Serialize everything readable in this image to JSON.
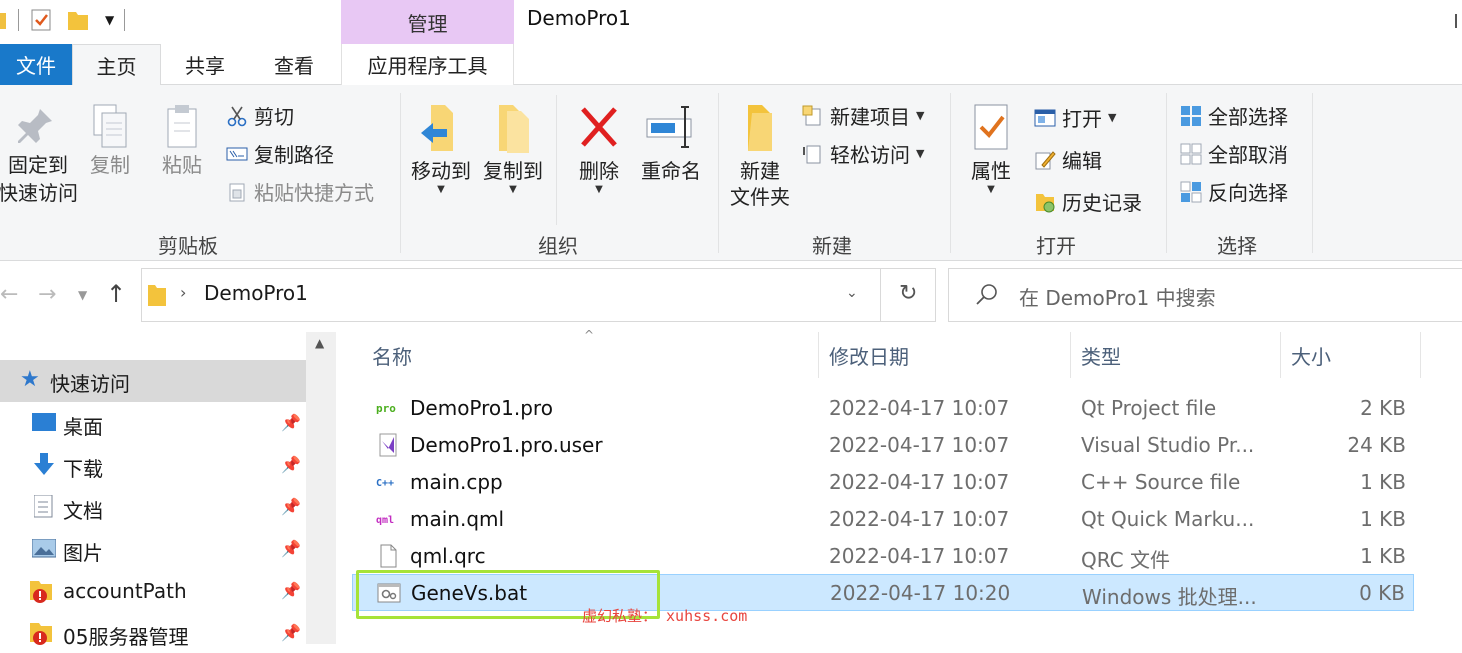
{
  "window": {
    "title": "DemoPro1",
    "context_tab_header": "管理"
  },
  "tabs": {
    "file": "文件",
    "home": "主页",
    "share": "共享",
    "view": "查看",
    "app_tools": "应用程序工具"
  },
  "ribbon": {
    "clipboard": {
      "label": "剪贴板",
      "pin_quick_line1": "固定到",
      "pin_quick_line2": "快速访问",
      "copy": "复制",
      "paste": "粘贴",
      "cut": "剪切",
      "copy_path": "复制路径",
      "paste_shortcut": "粘贴快捷方式"
    },
    "organize": {
      "label": "组织",
      "move_to": "移动到",
      "copy_to": "复制到",
      "delete": "删除",
      "rename": "重命名"
    },
    "new": {
      "label": "新建",
      "new_folder_line1": "新建",
      "new_folder_line2": "文件夹",
      "new_item": "新建项目",
      "easy_access": "轻松访问"
    },
    "open": {
      "label": "打开",
      "properties": "属性",
      "open": "打开",
      "edit": "编辑",
      "history": "历史记录"
    },
    "select": {
      "label": "选择",
      "select_all": "全部选择",
      "select_none": "全部取消",
      "invert": "反向选择"
    }
  },
  "address": {
    "path": "DemoPro1",
    "search_placeholder": "在 DemoPro1 中搜索"
  },
  "nav": {
    "quick_access": "快速访问",
    "items": [
      {
        "label": "桌面",
        "icon": "desktop-icon"
      },
      {
        "label": "下载",
        "icon": "download-icon"
      },
      {
        "label": "文档",
        "icon": "document-icon"
      },
      {
        "label": "图片",
        "icon": "picture-icon"
      },
      {
        "label": "accountPath",
        "icon": "folder-icon"
      },
      {
        "label": "05服务器管理",
        "icon": "folder-icon"
      }
    ]
  },
  "columns": {
    "name": "名称",
    "modified": "修改日期",
    "type": "类型",
    "size": "大小"
  },
  "files": [
    {
      "name": "DemoPro1.pro",
      "modified": "2022-04-17 10:07",
      "type": "Qt Project file",
      "size": "2 KB",
      "icon": "pro-file-icon"
    },
    {
      "name": "DemoPro1.pro.user",
      "modified": "2022-04-17 10:07",
      "type": "Visual Studio Pr...",
      "size": "24 KB",
      "icon": "visual-studio-file-icon"
    },
    {
      "name": "main.cpp",
      "modified": "2022-04-17 10:07",
      "type": "C++ Source file",
      "size": "1 KB",
      "icon": "cpp-file-icon"
    },
    {
      "name": "main.qml",
      "modified": "2022-04-17 10:07",
      "type": "Qt Quick Marku...",
      "size": "1 KB",
      "icon": "qml-file-icon"
    },
    {
      "name": "qml.qrc",
      "modified": "2022-04-17 10:07",
      "type": "QRC 文件",
      "size": "1 KB",
      "icon": "generic-file-icon"
    },
    {
      "name": "GeneVs.bat",
      "modified": "2022-04-17 10:20",
      "type": "Windows 批处理...",
      "size": "0 KB",
      "icon": "batch-file-icon",
      "selected": true
    }
  ],
  "watermark": "虚幻私塾： xuhss.com",
  "colors": {
    "accent": "#1979ca",
    "selection": "#cce8ff",
    "context_tab": "#e8c8f4",
    "highlight": "#a6e33a",
    "watermark": "#e8463f"
  }
}
